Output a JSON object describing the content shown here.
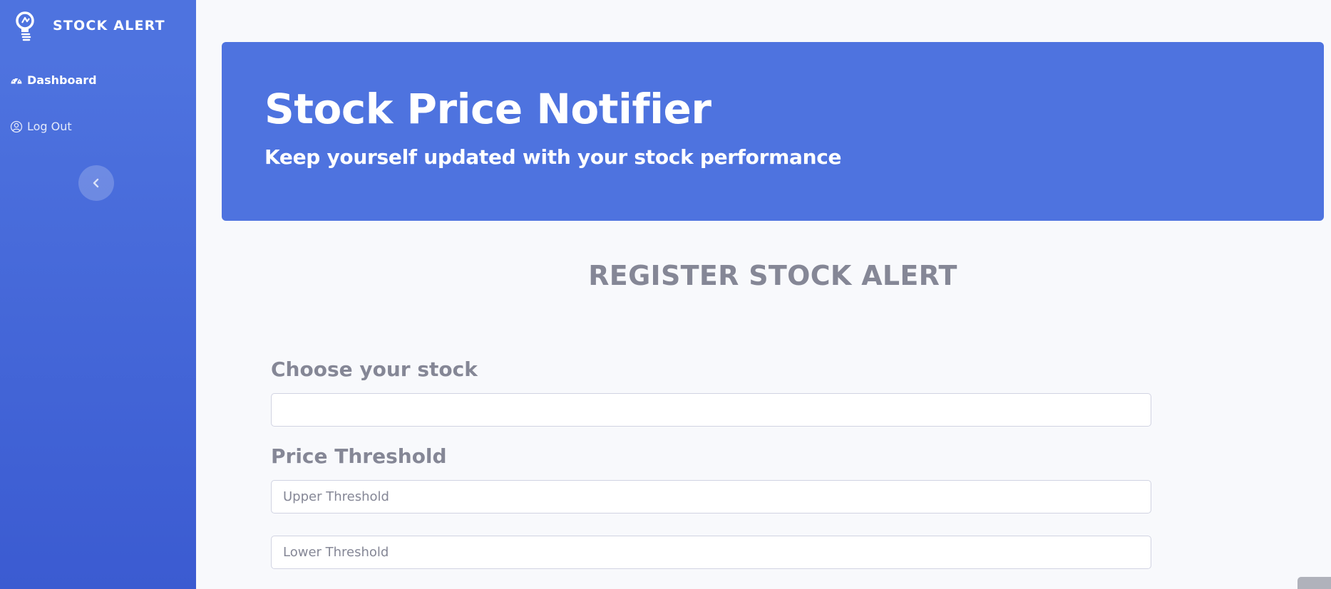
{
  "sidebar": {
    "brand": "STOCK ALERT",
    "items": [
      {
        "label": "Dashboard",
        "icon": "gauge-icon"
      },
      {
        "label": "Log Out",
        "icon": "user-circle-icon"
      }
    ],
    "toggle_icon": "chevron-left-icon"
  },
  "hero": {
    "title": "Stock Price Notifier",
    "subtitle": "Keep yourself updated with your stock performance"
  },
  "form": {
    "heading": "REGISTER STOCK ALERT",
    "stock_label": "Choose your stock",
    "stock_value": "",
    "price_label": "Price Threshold",
    "upper_placeholder": "Upper Threshold",
    "lower_placeholder": "Lower Threshold"
  },
  "colors": {
    "primary": "#4e73df",
    "muted_text": "#858796",
    "background": "#f8f9fc"
  }
}
